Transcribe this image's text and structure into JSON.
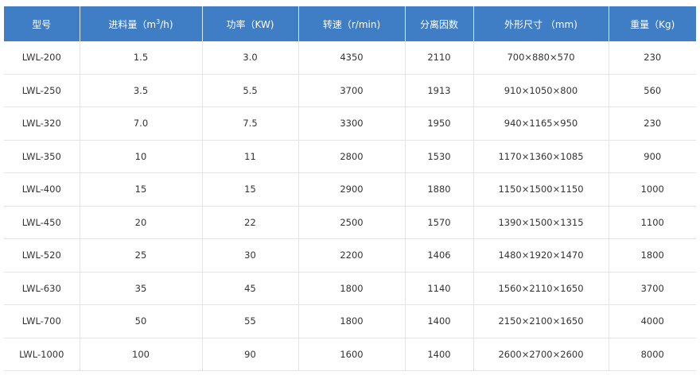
{
  "headers": [
    {
      "pre": "型号",
      "sup": "",
      "post": ""
    },
    {
      "pre": "进料量（m",
      "sup": "3",
      "post": "/h)"
    },
    {
      "pre": "功率（KW)",
      "sup": "",
      "post": ""
    },
    {
      "pre": "转速（r/min)",
      "sup": "",
      "post": ""
    },
    {
      "pre": "分离因数",
      "sup": "",
      "post": ""
    },
    {
      "pre": "外形尺寸 （mm)",
      "sup": "",
      "post": ""
    },
    {
      "pre": "重量（Kg)",
      "sup": "",
      "post": ""
    }
  ],
  "rows": [
    [
      "LWL-200",
      "1.5",
      "3.0",
      "4350",
      "2110",
      "700×880×570",
      "230"
    ],
    [
      "LWL-250",
      "3.5",
      "5.5",
      "3700",
      "1913",
      "910×1050×800",
      "560"
    ],
    [
      "LWL-320",
      "7.0",
      "7.5",
      "3300",
      "1950",
      "940×1165×950",
      "230"
    ],
    [
      "LWL-350",
      "10",
      "11",
      "2800",
      "1530",
      "1170×1360×1085",
      "900"
    ],
    [
      "LWL-400",
      "15",
      "15",
      "2900",
      "1880",
      "1150×1500×1150",
      "1000"
    ],
    [
      "LWL-450",
      "20",
      "22",
      "2500",
      "1570",
      "1390×1500×1315",
      "1100"
    ],
    [
      "LWL-520",
      "25",
      "30",
      "2200",
      "1406",
      "1480×1920×1470",
      "1800"
    ],
    [
      "LWL-630",
      "35",
      "45",
      "1800",
      "1140",
      "1560×2110×1650",
      "3700"
    ],
    [
      "LWL-700",
      "50",
      "55",
      "1800",
      "1400",
      "2150×2100×1650",
      "4000"
    ],
    [
      "LWL-1000",
      "100",
      "90",
      "1600",
      "1400",
      "2600×2700×2600",
      "8000"
    ]
  ],
  "colors": {
    "header_bg": "#3f7dc4",
    "header_text": "#ffffff",
    "cell_text": "#333333",
    "grid_line": "#e4e4e4"
  }
}
